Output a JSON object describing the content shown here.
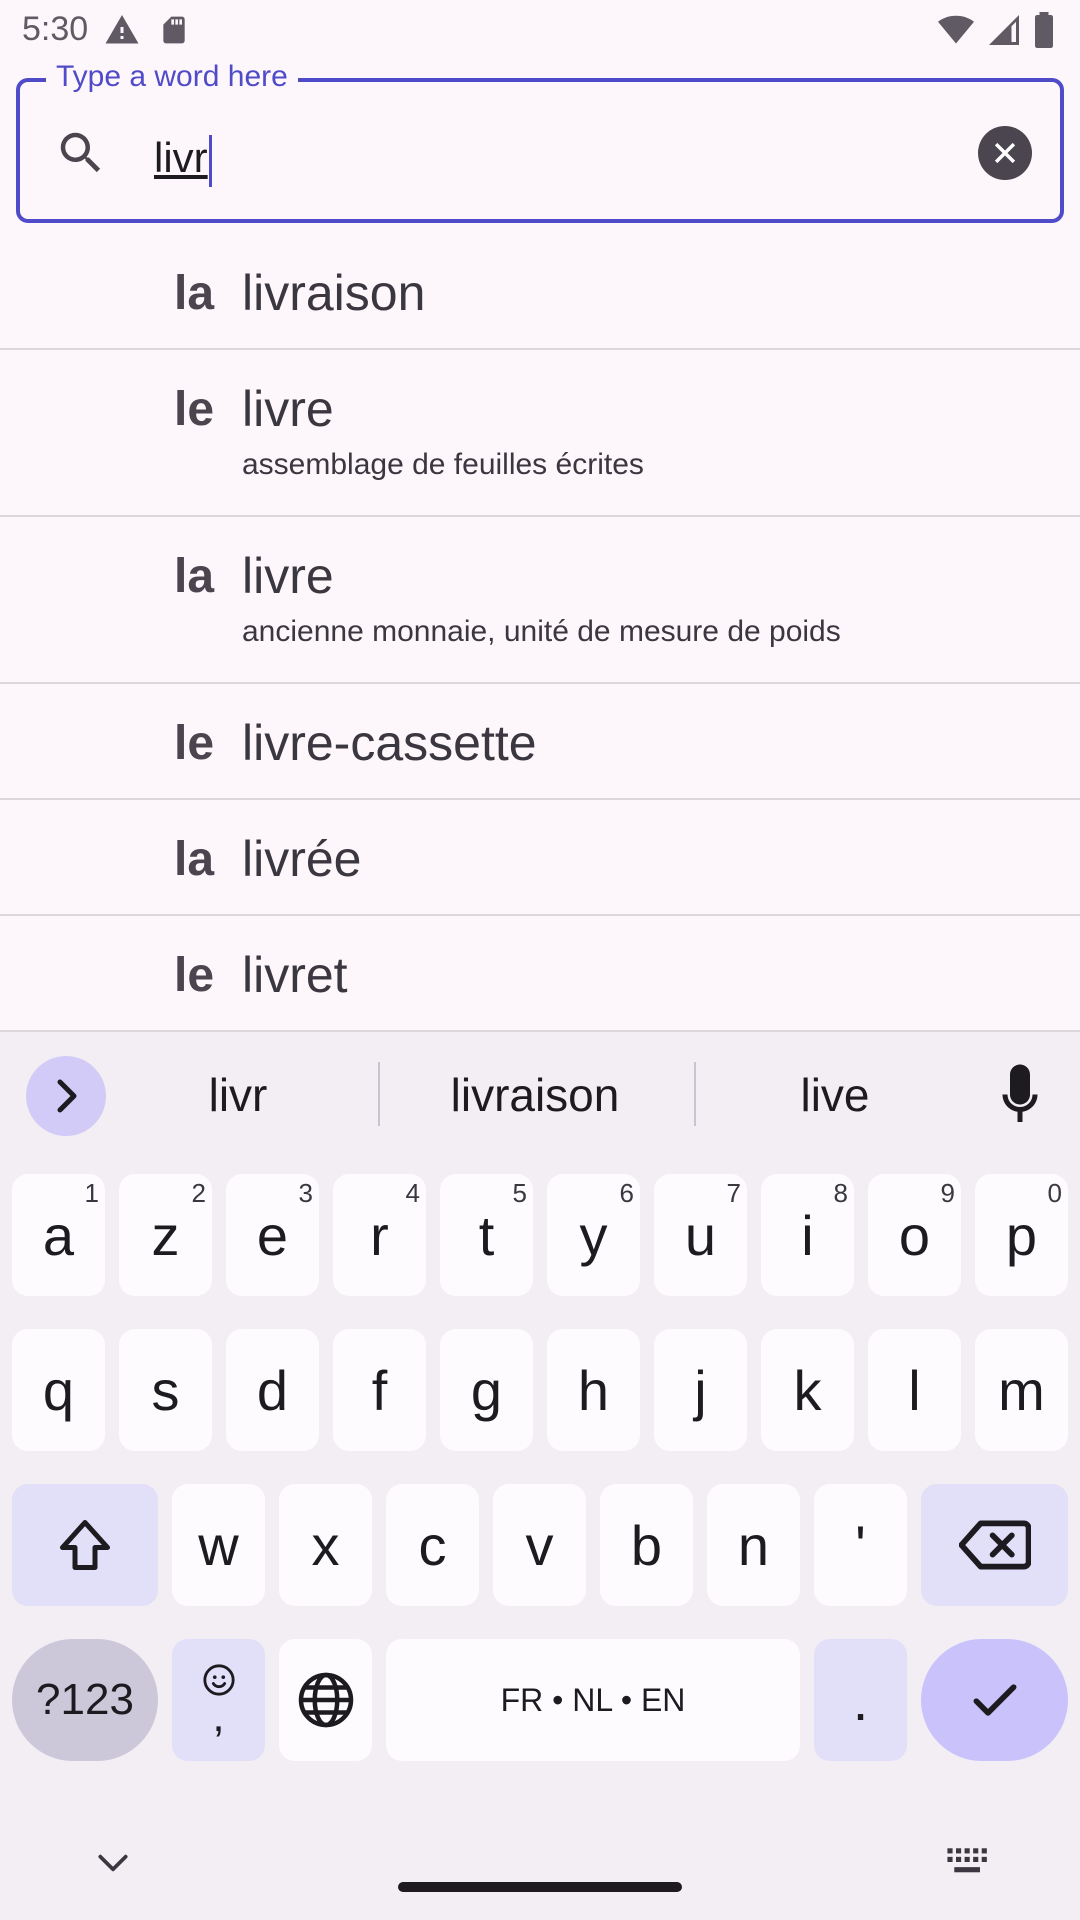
{
  "status_bar": {
    "time": "5:30"
  },
  "search": {
    "label": "Type a word here",
    "value": "livr"
  },
  "results": [
    {
      "article": "la",
      "word": "livraison",
      "definition": ""
    },
    {
      "article": "le",
      "word": "livre",
      "definition": "assemblage de feuilles écrites"
    },
    {
      "article": "la",
      "word": "livre",
      "definition": "ancienne monnaie, unité de mesure de poids"
    },
    {
      "article": "le",
      "word": "livre-cassette",
      "definition": ""
    },
    {
      "article": "la",
      "word": "livrée",
      "definition": ""
    },
    {
      "article": "le",
      "word": "livret",
      "definition": ""
    }
  ],
  "keyboard": {
    "suggestions": [
      "livr",
      "livraison",
      "live"
    ],
    "row1": [
      {
        "key": "a",
        "hint": "1"
      },
      {
        "key": "z",
        "hint": "2"
      },
      {
        "key": "e",
        "hint": "3"
      },
      {
        "key": "r",
        "hint": "4"
      },
      {
        "key": "t",
        "hint": "5"
      },
      {
        "key": "y",
        "hint": "6"
      },
      {
        "key": "u",
        "hint": "7"
      },
      {
        "key": "i",
        "hint": "8"
      },
      {
        "key": "o",
        "hint": "9"
      },
      {
        "key": "p",
        "hint": "0"
      }
    ],
    "row2": [
      "q",
      "s",
      "d",
      "f",
      "g",
      "h",
      "j",
      "k",
      "l",
      "m"
    ],
    "row3": [
      "w",
      "x",
      "c",
      "v",
      "b",
      "n",
      "'"
    ],
    "symbols_label": "?123",
    "comma_label": ",",
    "space_label": "FR • NL • EN",
    "period_label": "."
  },
  "colors": {
    "accent": "#4f4bc9",
    "key_modifier": "#e2dff8",
    "action_key": "#c9c2fb",
    "background": "#fdf7fb"
  }
}
